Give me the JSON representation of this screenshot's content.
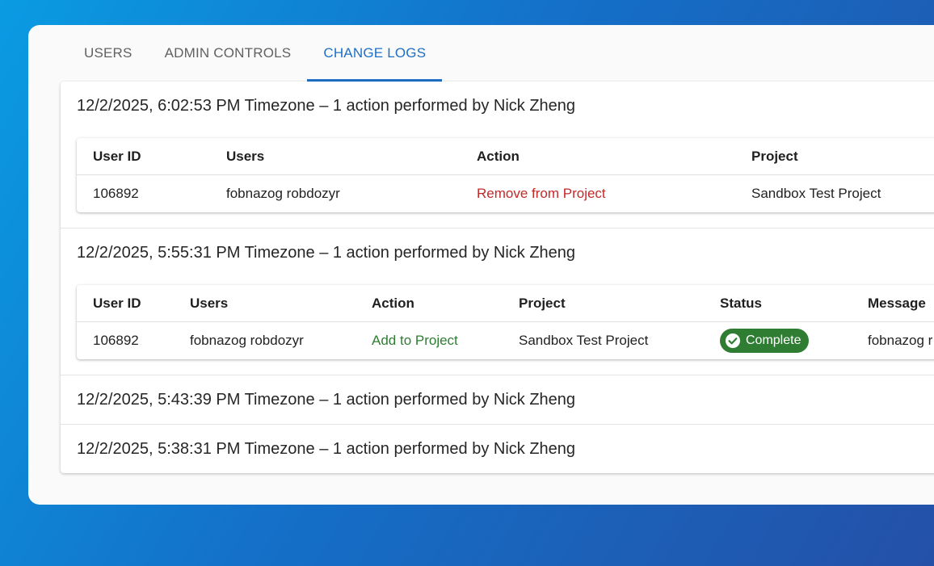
{
  "tabs": [
    {
      "label": "USERS"
    },
    {
      "label": "ADMIN CONTROLS"
    },
    {
      "label": "CHANGE LOGS"
    }
  ],
  "logs": [
    {
      "header": "12/2/2025, 6:02:53 PM Timezone – 1 action performed by Nick Zheng",
      "columns": [
        "User ID",
        "Users",
        "Action",
        "Project"
      ],
      "row": {
        "user_id": "106892",
        "user": "fobnazog robdozyr",
        "action": "Remove from Project",
        "project": "Sandbox Test Project"
      }
    },
    {
      "header": "12/2/2025, 5:55:31 PM Timezone – 1 action performed by Nick Zheng",
      "columns": [
        "User ID",
        "Users",
        "Action",
        "Project",
        "Status",
        "Message"
      ],
      "row": {
        "user_id": "106892",
        "user": "fobnazog robdozyr",
        "action": "Add to Project",
        "project": "Sandbox Test Project",
        "status": "Complete",
        "message": "fobnazog r"
      }
    },
    {
      "header": "12/2/2025, 5:43:39 PM Timezone – 1 action performed by Nick Zheng"
    },
    {
      "header": "12/2/2025, 5:38:31 PM Timezone – 1 action performed by Nick Zheng"
    }
  ],
  "colors": {
    "accent": "#1e6fc5",
    "remove_action": "#c62828",
    "add_action": "#2e7d32",
    "status_complete": "#2e7d32"
  },
  "icons": {
    "status": "check-circle-icon"
  }
}
